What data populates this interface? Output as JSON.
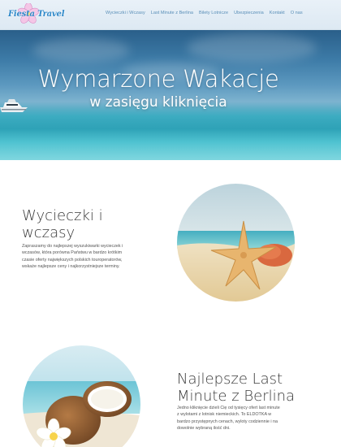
{
  "brand": {
    "logo_text": "Fiesta Travel"
  },
  "nav": {
    "items": [
      "Wycieczki i Wczasy",
      "Last Minute z Berlina",
      "Bilety Lotnicze",
      "Ubezpieczenia",
      "Kontakt",
      "O nas"
    ]
  },
  "hero": {
    "title": "Wymarzone Wakacje",
    "subtitle": "w zasięgu kliknięcia"
  },
  "section1": {
    "title_line1": "Wycieczki i",
    "title_line2": "wczasy",
    "text_lines": [
      "Zapraszamy do najlepszej wyszukiwarki wycieczek i",
      "wczasów, która porówna Państwu w bardzo krótkim",
      "czasie oferty największych polskich touroperatorów,",
      "wskaże najlepsze ceny i najkorzystniejsze terminy."
    ]
  },
  "section2": {
    "title_line1": "Najlepsze Last",
    "title_line2": "Minute z Berlina",
    "text_lines": [
      "Jedno kliknięcie dzieli Cię od tysięcy ofert last minute",
      "z wylotami z lotnisk niemieckich. To ELDOTKA w",
      "bardzo przystępnych cenach, wyloty codziennie i na",
      "dowolnie wybraną ilość dni."
    ]
  },
  "colors": {
    "header_bg": "#e4eef6",
    "nav_link": "#5a8fb8",
    "logo": "#2f89c9",
    "heading": "#3a3a3a",
    "body_text": "#555555"
  },
  "icons": [
    "flower-logo-icon"
  ]
}
